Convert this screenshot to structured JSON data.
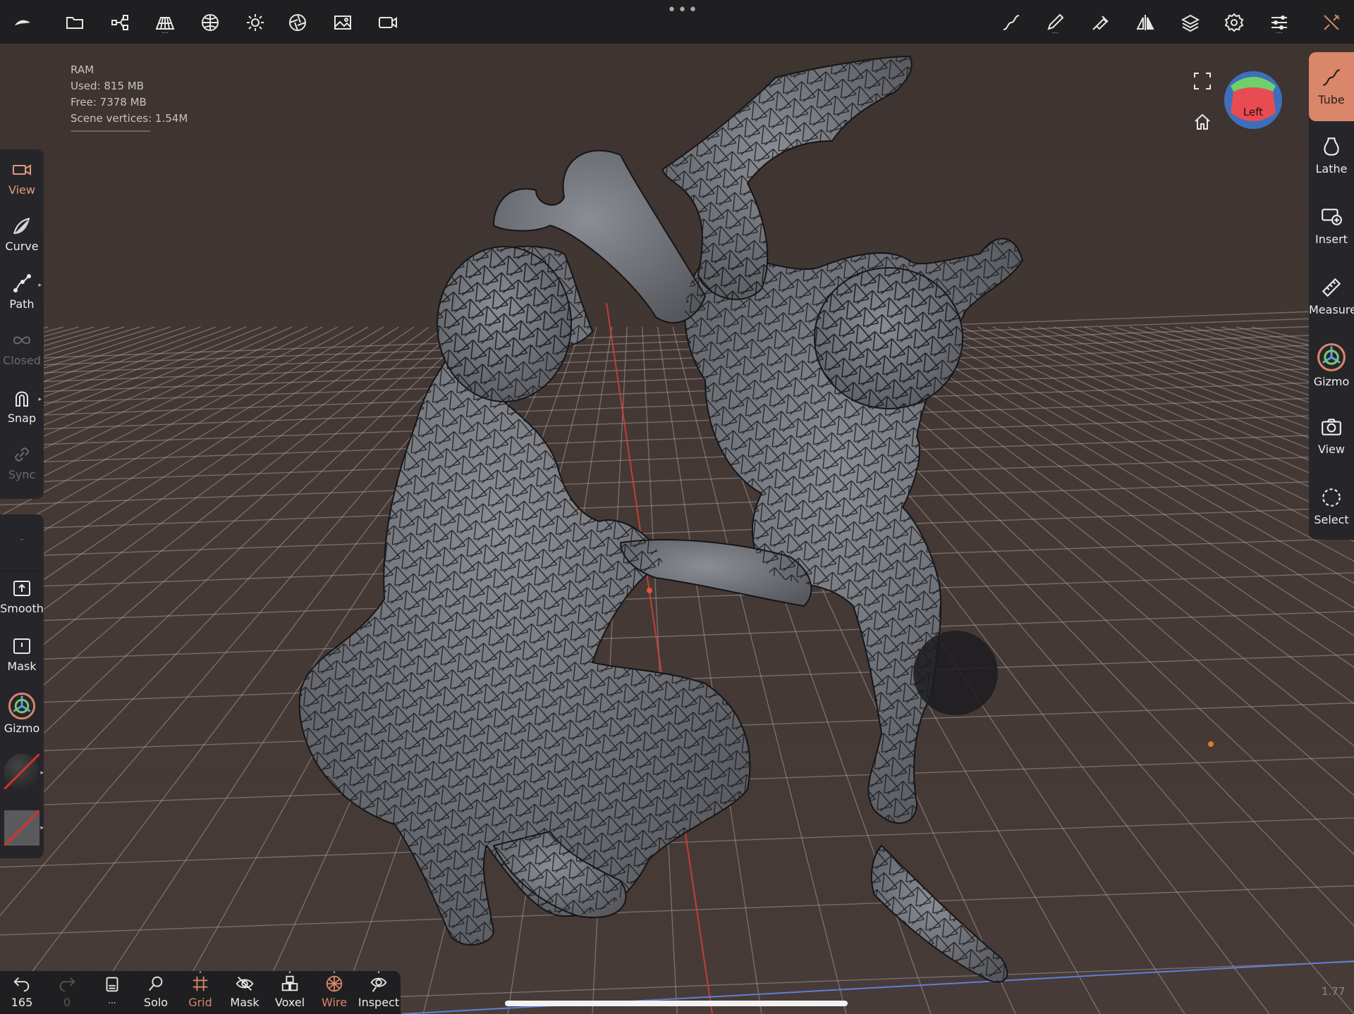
{
  "info": {
    "title": "RAM",
    "used": "Used:  815 MB",
    "free": "Free:  7378 MB",
    "vertices": "Scene vertices:  1.54M",
    "separator": "--------------------------------------"
  },
  "left_panel": {
    "view": "View",
    "curve": "Curve",
    "path": "Path",
    "closed": "Closed",
    "snap": "Snap",
    "sync": "Sync",
    "dash": "-",
    "smooth": "Smooth",
    "mask": "Mask",
    "gizmo": "Gizmo"
  },
  "right_panel": {
    "tube": "Tube",
    "lathe": "Lathe",
    "insert": "Insert",
    "measure": "Measure",
    "gizmo": "Gizmo",
    "view": "View",
    "select": "Select"
  },
  "bottom_bar": {
    "undo_count": "165",
    "redo_count": "0",
    "solo": "Solo",
    "grid": "Grid",
    "mask": "Mask",
    "voxel": "Voxel",
    "wire": "Wire",
    "inspect": "Inspect",
    "dots": "..."
  },
  "nav_cube": {
    "face": "Left"
  },
  "zoom_value": "1.77",
  "colors": {
    "accent": "#d9866a",
    "panel": "#26262a",
    "topbar": "#1f1f21",
    "background": "#3a302d"
  }
}
